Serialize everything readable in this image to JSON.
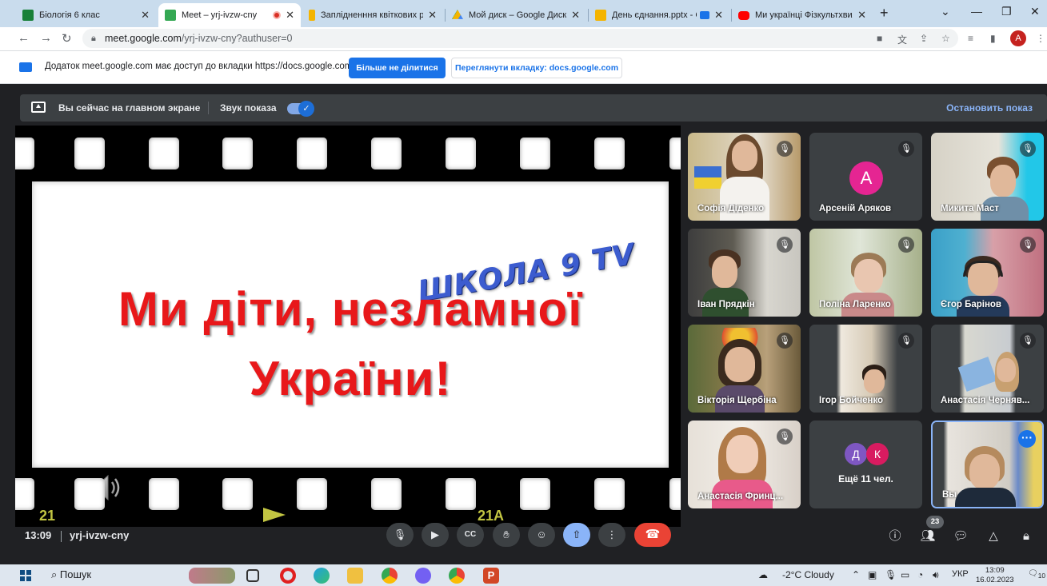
{
  "browser": {
    "tabs": [
      {
        "title": "Біологія 6 клас",
        "color": "#188038"
      },
      {
        "title": "Meet – yrj-ivzw-cny",
        "color": "#34a853"
      },
      {
        "title": "Заплідненння квіткових рос",
        "color": "#f4b400"
      },
      {
        "title": "Мой диск – Google Диск",
        "color": "#4285f4"
      },
      {
        "title": "День єднання.pptx - G",
        "color": "#f4b400"
      },
      {
        "title": "Ми українці Фізкультхвил",
        "color": "#ff0000"
      }
    ],
    "url_host": "meet.google.com",
    "url_path": "/yrj-ivzw-cny?authuser=0",
    "profile_initial": "A"
  },
  "infobar": {
    "message": "Додаток meet.google.com має доступ до вкладки https://docs.google.com",
    "stop_sharing": "Більше не ділитися",
    "view_tab": "Переглянути вкладку: docs.google.com"
  },
  "meet": {
    "presenting_text": "Вы сейчас на главном экране",
    "sound_label": "Звук показа",
    "stop_presenting": "Остановить показ",
    "time": "13:09",
    "code": "yrj-ivzw-cny",
    "participants_badge": "23",
    "slide": {
      "school": "ШКОЛА 9 TV",
      "line1": "Ми діти, незламної",
      "line2": "України!",
      "film_left": "21",
      "film_right": "21A"
    },
    "participants": [
      {
        "name": "Софія Діденко"
      },
      {
        "name": "Арсеній Аряков",
        "initial": "A"
      },
      {
        "name": "Микита Маст"
      },
      {
        "name": "Іван Прядкін"
      },
      {
        "name": "Поліна Ларенко"
      },
      {
        "name": "Єгор Барінов"
      },
      {
        "name": "Вікторія Щербіна"
      },
      {
        "name": "Ігор Бойченко"
      },
      {
        "name": "Анастасія Черняв..."
      },
      {
        "name": "Анастасія Фринц..."
      },
      {
        "name": "Ещё 11 чел.",
        "initials": [
          "Д",
          "К"
        ]
      },
      {
        "name": "Вы"
      }
    ]
  },
  "taskbar": {
    "search": "Пошук",
    "weather": "-2°C  Cloudy",
    "lang": "УКР",
    "time": "13:09",
    "date": "16.02.2023",
    "notifications": "10"
  },
  "colors": {
    "meet_bg": "#202124",
    "accent": "#1a73e8",
    "slide_red": "#e8181a",
    "slide_blue": "#3c5ccf",
    "hangup": "#ea4335"
  }
}
